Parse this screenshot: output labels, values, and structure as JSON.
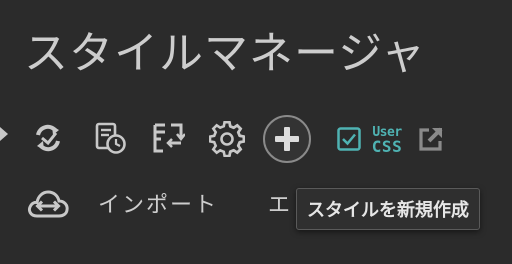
{
  "header": {
    "title": "スタイルマネージャ"
  },
  "toolbar": {
    "buttons": [
      {
        "name": "expand-arrow-icon"
      },
      {
        "name": "check-updates-icon"
      },
      {
        "name": "history-icon"
      },
      {
        "name": "sort-icon"
      },
      {
        "name": "gear-icon"
      },
      {
        "name": "add-style-icon"
      },
      {
        "name": "checkbox-icon",
        "checked": true
      },
      {
        "name": "usercss-icon",
        "text_top": "User",
        "text_bottom": "CSS"
      },
      {
        "name": "external-link-icon"
      }
    ],
    "usercss_top": "User",
    "usercss_bottom": "CSS"
  },
  "import": {
    "label": "インポート",
    "export_partial": "エ"
  },
  "tooltip": {
    "text": "スタイルを新規作成"
  },
  "colors": {
    "background": "#2b2b2b",
    "text": "#cdcdcd",
    "icon": "#c8c8c8",
    "accent": "#4fb3b3",
    "tooltip_bg": "#2f2f2f"
  }
}
